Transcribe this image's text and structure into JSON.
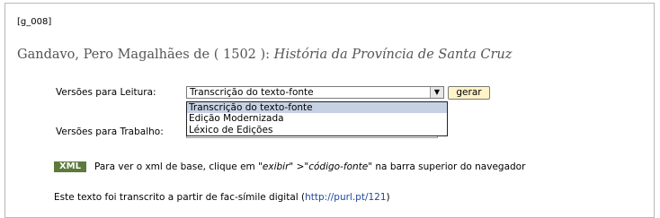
{
  "code": "[g_008]",
  "title": {
    "author": "Gandavo, Pero Magalhães de ( 1502 ):",
    "work": "História da Província de Santa Cruz"
  },
  "leitura": {
    "label": "Versões para Leitura:",
    "selected": "Transcrição do texto-fonte",
    "options": [
      "Transcrição do texto-fonte",
      "Edição Modernizada",
      "Léxico de Edições"
    ],
    "button": "gerar"
  },
  "trabalho": {
    "label": "Versões para Trabalho:"
  },
  "xml": {
    "badge": "XML",
    "note_a": "Para ver o xml de base, clique em ",
    "note_b": "\"exibir\"",
    "note_c": " >",
    "note_d": "\"código-fonte\"",
    "note_e": " na barra superior do navegador"
  },
  "source": {
    "text": "Este texto foi transcrito a partir de fac-símile digital (",
    "link": "http://purl.pt/121",
    "close": ")"
  },
  "colors": {
    "badge": "#5d7a3b",
    "button": "#fff3c8",
    "highlight": "#c6d2e4",
    "link": "#20479e"
  }
}
